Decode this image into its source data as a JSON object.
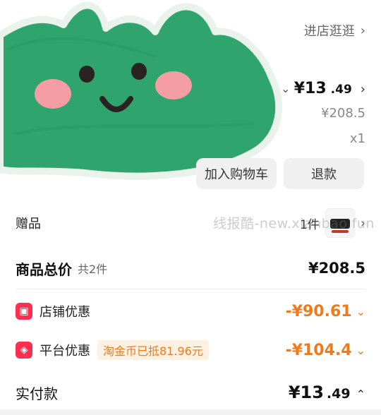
{
  "header": {
    "store_link": "进店逛逛"
  },
  "product": {
    "price_symbol": "¥",
    "price_main": "13",
    "price_small": ".49",
    "original_price": "¥208.5",
    "quantity": "x1"
  },
  "actions": {
    "add_to_cart": "加入购物车",
    "refund": "退款"
  },
  "gift": {
    "label": "赠品",
    "count": "1件"
  },
  "watermark": "线报酷-new.xianbao.fun",
  "summary": {
    "total_label": "商品总价",
    "total_sub": "共2件",
    "total_value": "¥208.5"
  },
  "discounts": [
    {
      "label": "店铺优惠",
      "value": "-¥90.61",
      "icon": "shop-icon"
    },
    {
      "label": "平台优惠",
      "badge": "淘金币已抵81.96元",
      "value": "-¥104.4",
      "icon": "platform-icon"
    }
  ],
  "paid": {
    "label": "实付款",
    "symbol": "¥",
    "main": "13",
    "small": ".49"
  },
  "colors": {
    "accent_orange": "#f07a1a",
    "icon_red": "#ff2f4f",
    "sticker_green": "#2fa56d"
  }
}
